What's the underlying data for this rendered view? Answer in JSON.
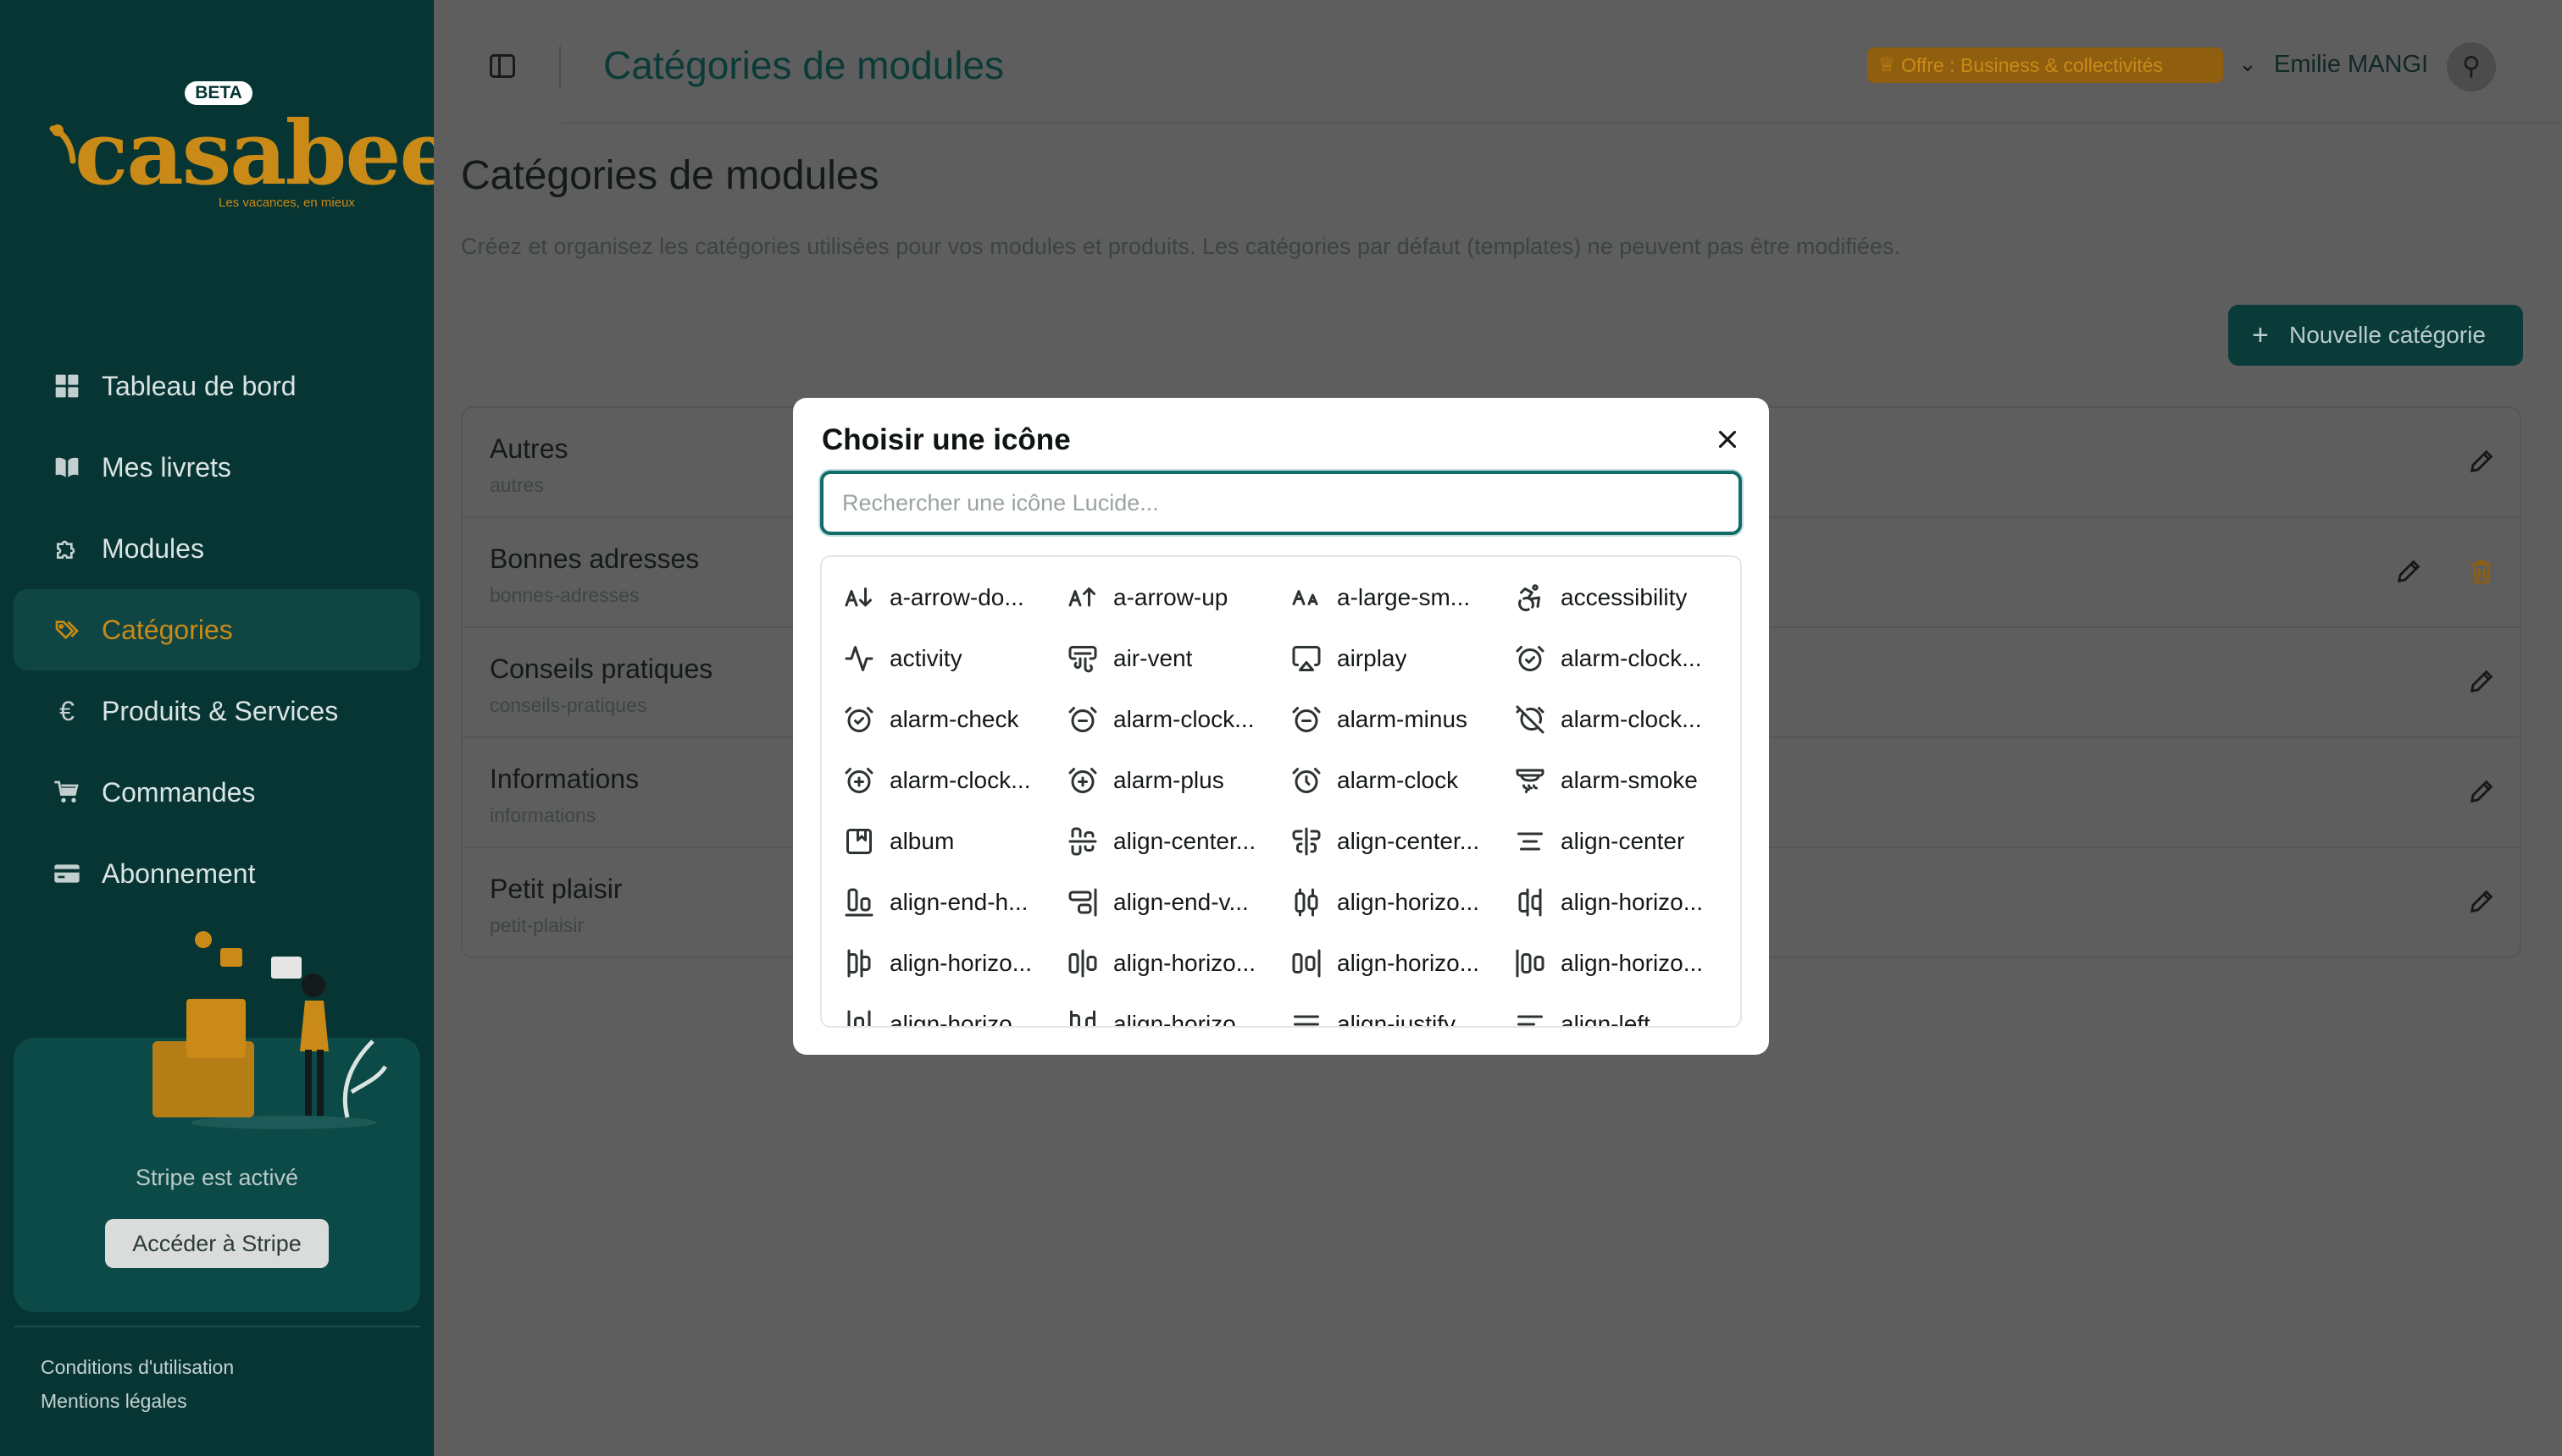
{
  "sidebar": {
    "beta": "BETA",
    "logo_text": "casabee",
    "tagline": "Les vacances, en mieux",
    "items": [
      {
        "label": "Tableau de bord",
        "icon": "dashboard-icon"
      },
      {
        "label": "Mes livrets",
        "icon": "book-icon"
      },
      {
        "label": "Modules",
        "icon": "puzzle-icon"
      },
      {
        "label": "Catégories",
        "icon": "tags-icon"
      },
      {
        "label": "Produits & Services",
        "icon": "euro-icon"
      },
      {
        "label": "Commandes",
        "icon": "cart-icon"
      },
      {
        "label": "Abonnement",
        "icon": "credit-card-icon"
      }
    ],
    "stripe_text": "Stripe est activé",
    "stripe_button": "Accéder à Stripe",
    "footer_terms": "Conditions d'utilisation",
    "footer_legal": "Mentions légales"
  },
  "header": {
    "title": "Catégories de modules",
    "offer": "Offre : Business & collectivités",
    "user_name": "Emilie MANGI"
  },
  "main": {
    "heading": "Catégories de modules",
    "description": "Créez et organisez les catégories utilisées pour vos modules et produits. Les catégories par défaut (templates) ne peuvent pas être modifiées.",
    "new_button": "Nouvelle catégorie",
    "rows": [
      {
        "title": "Autres",
        "slug": "autres"
      },
      {
        "title": "Bonnes adresses",
        "slug": "bonnes-adresses"
      },
      {
        "title": "Conseils pratiques",
        "slug": "conseils-pratiques"
      },
      {
        "title": "Informations",
        "slug": "informations"
      },
      {
        "title": "Petit plaisir",
        "slug": "petit-plaisir"
      }
    ]
  },
  "modal": {
    "title": "Choisir une icône",
    "search_placeholder": "Rechercher une icône Lucide...",
    "icons": [
      "a-arrow-do...",
      "a-arrow-up",
      "a-large-sm...",
      "accessibility",
      "activity",
      "air-vent",
      "airplay",
      "alarm-clock...",
      "alarm-check",
      "alarm-clock...",
      "alarm-minus",
      "alarm-clock...",
      "alarm-clock...",
      "alarm-plus",
      "alarm-clock",
      "alarm-smoke",
      "album",
      "align-center...",
      "align-center...",
      "align-center",
      "align-end-h...",
      "align-end-v...",
      "align-horizo...",
      "align-horizo...",
      "align-horizo...",
      "align-horizo...",
      "align-horizo...",
      "align-horizo...",
      "align-horizo...",
      "align-horizo...",
      "align-justify",
      "align-left"
    ]
  }
}
